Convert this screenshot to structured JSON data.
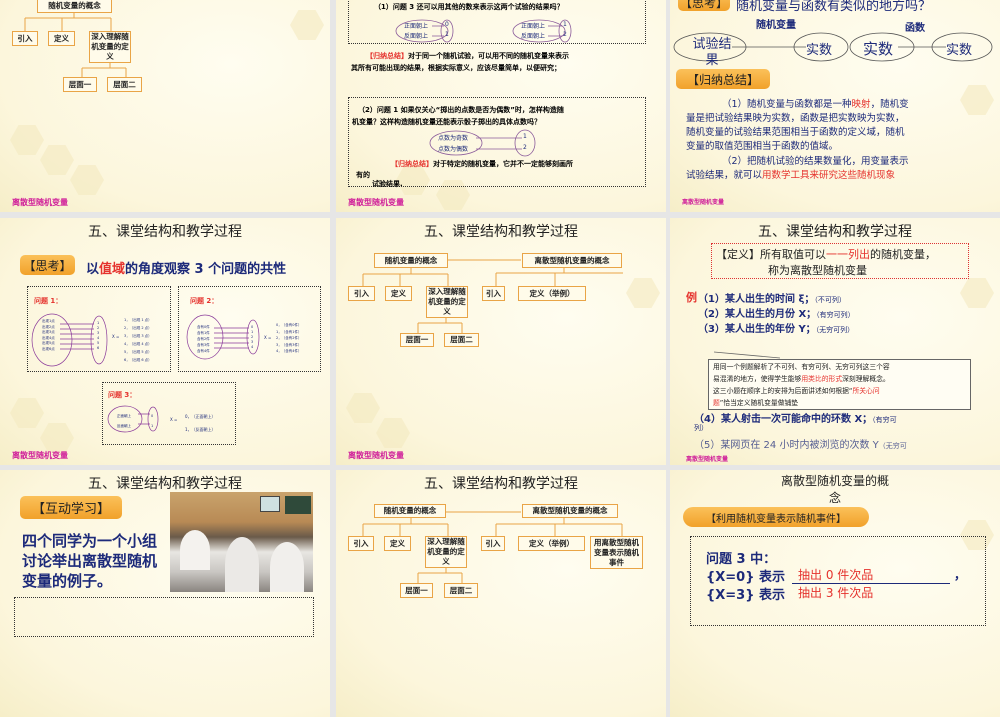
{
  "footer": "离散型随机变量",
  "section_title": "五、课堂结构和教学过程",
  "org": {
    "root1": "随机变量的概念",
    "intro": "引入",
    "define": "定义",
    "deep": "深入理解随机变量的定义",
    "level1": "层面一",
    "level2": "层面二",
    "root2": "离散型随机变量的概念",
    "intro2": "引入",
    "define2": "定义（举例）",
    "events": "用离散型随机变量表示随机事件"
  },
  "slide2": {
    "q1": "（1）问题 3 还可以用其他的数来表示这两个试验的结果吗？",
    "heads": "正面朝上",
    "tails": "反面朝上",
    "v0": "0",
    "v1": "1",
    "w1": "1",
    "w2": "2",
    "sum_label": "【归纳总结】",
    "sum1_a": "对于同一个随机试验，可以用不同的随机变量来表示",
    "sum1_b": "其所有可能出现的结果，根据实际意义，应该尽量简单，以便研究；",
    "q2_a": "（2）问题 1 如果仅关心“掷出的点数是否为偶数”时，怎样构造随",
    "q2_b": "机变量？这样构造随机变量还能表示骰子掷出的具体点数吗？",
    "odd": "点数为奇数",
    "even": "点数为偶数",
    "p1": "1",
    "p2": "2",
    "sum2_a": "对于特定的随机变量，它并不一定能够刻画所",
    "sum2_b": "有的",
    "sum2_c": "试验结果."
  },
  "slide3": {
    "think": "【思考】",
    "question": "随机变量与函数有类似的地方吗？",
    "rv": "随机变量",
    "func": "函数",
    "outcome": "试验结果",
    "real1": "实数",
    "real2": "实数",
    "real3": "实数",
    "sum": "【归纳总结】",
    "p1_a": "（1）随机变量与函数都是一种",
    "p1_red": "映射",
    "p1_b": "，随机变",
    "p1_c": "量是把试验结果映为实数，函数是把实数映为实数，",
    "p1_d": "随机变量的试验结果范围相当于函数的定义域，随机",
    "p1_e": "变量的取值范围相当于函数的值域。",
    "p2_a": "（2）把随机试验的结果数量化，用变量表示",
    "p2_b": "试验结果，就可以",
    "p2_red": "用数学工具来研究这些随机现象"
  },
  "slide4": {
    "think": "【思考】",
    "t_a": "以",
    "t_red": "值域",
    "t_b": "的角度观察 3 个问题的共性",
    "q1": "问题 1：",
    "q2": "问题 2：",
    "q3": "问题 3：",
    "q1_left": [
      "出现1点",
      "出现2点",
      "出现3点",
      "出现4点",
      "出现5点",
      "出现6点"
    ],
    "q1_right": [
      "1",
      "2",
      "3",
      "4",
      "5",
      "6"
    ],
    "q1_cases": [
      "1，（出现 1 点）",
      "2，（出现 2 点）",
      "3，（出现 3 点）",
      "4，（出现 4 点）",
      "5，（出现 5 点）",
      "6，（出现 6 点）"
    ],
    "q2_left": [
      "含有0件",
      "含有1件",
      "含有2件",
      "含有3件",
      "含有4件"
    ],
    "q2_right": [
      "0",
      "1",
      "2",
      "3",
      "4"
    ],
    "q2_cases": [
      "0，（含有0件）",
      "1，（含有1件）",
      "2，（含有2件）",
      "3，（含有3件）",
      "4，（含有4件）"
    ],
    "q3_left": [
      "正面朝上",
      "反面朝上"
    ],
    "q3_right": [
      "0",
      "1"
    ],
    "q3_cases": [
      "0，（正面朝上）",
      "1，（反面朝上）"
    ],
    "x_eq": "X ="
  },
  "slide6": {
    "def_a": "【定义】所有取值可以",
    "def_red": "一一列出",
    "def_b": "的随机变量，",
    "def_c": "称为离散型随机变量",
    "ex": "例",
    "e1": "（1）某人出生的时间 ξ；",
    "e1n": "（不可列）",
    "e2": "（2）某人出生的月份 X；",
    "e2n": "（有穷可列）",
    "e3": "（3）某人出生的年份 Y；",
    "e3n": "（无穷可列）",
    "note_a": "用同一个例题解析了不可列、有穷可列、无穷可列这三个容",
    "note_b": "易混淆的地方，使得学生能够",
    "note_red1": "用类比的形式",
    "note_c": "深刻理解概念。",
    "note_d": "这三小题在顺序上的安排为后面讲述如何根据“",
    "note_red2": "所关心问",
    "note_red3": "题",
    "note_e": "”恰当定义随机变量做铺垫",
    "e4": "（4）某人射击一次可能命中的环数 X；",
    "e4n": "（有穷可",
    "e4n2": "列）",
    "e5": "（5）某网页在 24 小时内被浏览的次数 Y",
    "e5n": "（无穷可"
  },
  "slide7": {
    "badge": "【互动学习】",
    "t1": "四个同学为一个小组",
    "t2": "讨论举出离散型随机",
    "t3": "变量的例子。"
  },
  "slide9": {
    "title1": "离散型随机变量的概",
    "title2": "念",
    "badge": "【利用随机变量表示随机事件】",
    "q": "问题 3 中：",
    "l1": "{X=0} 表示",
    "a1": "抽出 0 件次品",
    "comma": "，",
    "l2": "{X=3} 表示",
    "a2": "抽出 3 件次品"
  },
  "colors": {
    "footer": "#d0209a",
    "accent": "#f1a12a",
    "red": "#e5322d",
    "navy": "#1d2a7a"
  }
}
